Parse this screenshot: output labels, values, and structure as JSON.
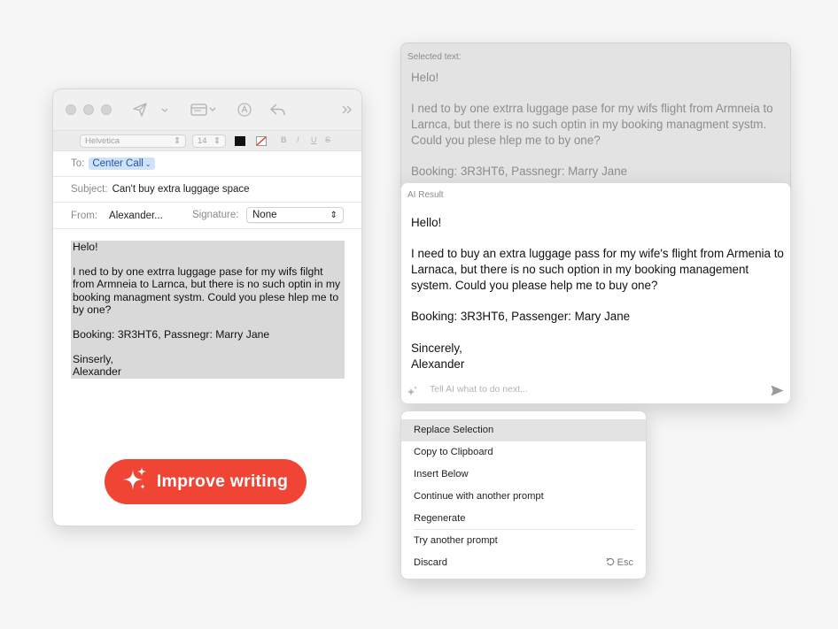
{
  "mail": {
    "font_name": "Helvetica",
    "font_size": "14",
    "format_bold": "B",
    "format_italic": "I",
    "format_underline": "U",
    "format_strike": "S",
    "to_label": "To:",
    "to_value": "Center Call",
    "subject_label": "Subject:",
    "subject_value": "Can't buy extra luggage space",
    "from_label": "From:",
    "from_value": "Alexander...",
    "signature_label": "Signature:",
    "signature_value": "None",
    "body": {
      "p1": "Helo!",
      "p2": "I ned to by one extrra luggage pase for my wifs filght from Armneia to Larnca, but there is no such optin in my booking managment systm. Could you plese hlep me to by one?",
      "p3": "Booking: 3R3HT6, Passnegr: Marry Jane",
      "p4": "Sinserly,\nAlexander"
    },
    "improve_label": "Improve writing"
  },
  "selected_panel": {
    "caption": "Selected text:",
    "p1": "Helo!",
    "p2": "I ned to by one extrra luggage pase for my wifs flight from Armneia to Larnca, but there is no such optin in my booking managment systm. Could you plese hlep me to by one?",
    "p3": "Booking: 3R3HT6, Passnegr: Marry Jane"
  },
  "ai_panel": {
    "caption": "AI Result",
    "p1": "Hello!",
    "p2": "I need to buy an extra luggage pass for my wife's flight from Armenia to Larnaca, but there is no such option in my booking management system. Could you please help me to buy one?",
    "p3": "Booking: 3R3HT6, Passenger: Mary Jane",
    "p4a": "Sincerely,",
    "p4b": "Alexander",
    "prompt_placeholder": "Tell AI what to do next..."
  },
  "menu": {
    "items": [
      "Replace Selection",
      "Copy to Clipboard",
      "Insert Below",
      "Continue with another prompt",
      "Regenerate",
      "Try another prompt",
      "Discard"
    ],
    "discard_shortcut": "Esc"
  },
  "colors": {
    "accent_red": "#f04435",
    "token_blue": "#cfe2f8",
    "selection_gray": "#d9d9d9"
  }
}
